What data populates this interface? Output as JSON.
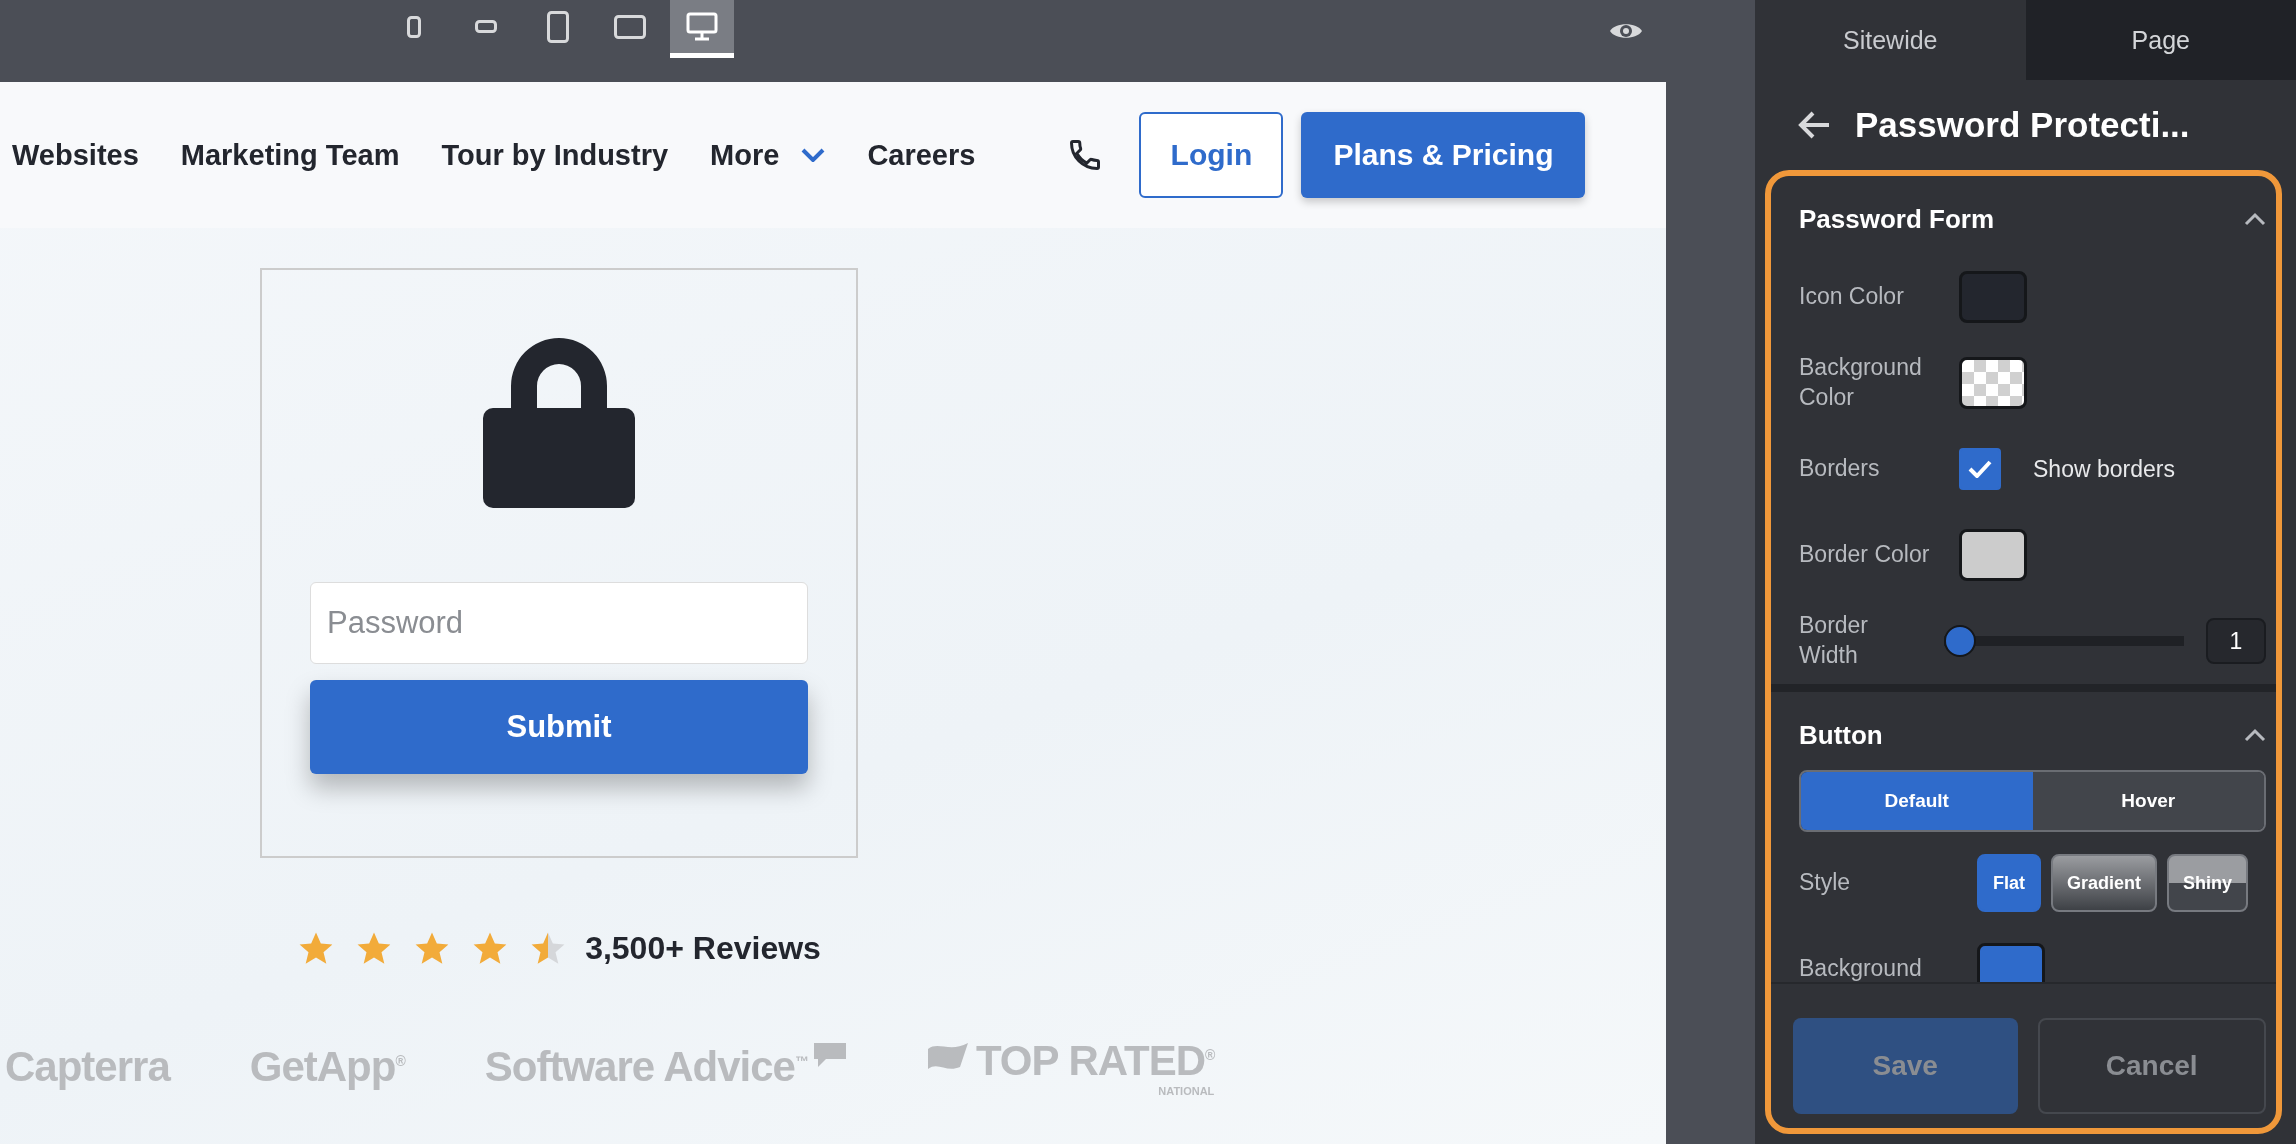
{
  "toolbar": {
    "devices": [
      {
        "kind": "phone-portrait",
        "selected": false
      },
      {
        "kind": "phone-landscape",
        "selected": false
      },
      {
        "kind": "tablet-portrait",
        "selected": false
      },
      {
        "kind": "tablet-landscape",
        "selected": false
      },
      {
        "kind": "desktop",
        "selected": true
      }
    ]
  },
  "nav": {
    "items": [
      {
        "label": "Websites",
        "dropdown": false
      },
      {
        "label": "Marketing Team",
        "dropdown": false
      },
      {
        "label": "Tour by Industry",
        "dropdown": false
      },
      {
        "label": "More",
        "dropdown": true
      },
      {
        "label": "Careers",
        "dropdown": false
      }
    ],
    "login": "Login",
    "cta": "Plans & Pricing"
  },
  "form": {
    "placeholder": "Password",
    "submit": "Submit"
  },
  "reviews": {
    "stars": 4.5,
    "text": "3,500+ Reviews"
  },
  "logos": [
    {
      "kind": "capterra",
      "text": "Capterra"
    },
    {
      "kind": "getapp",
      "text": "GetApp$^{®}$"
    },
    {
      "kind": "softwareadvice",
      "text": "Software Advice$^{™}$"
    },
    {
      "kind": "toprated",
      "text": "TOP RATED$^{®}$",
      "subtext": "NATIONAL"
    }
  ],
  "panel": {
    "tabs": [
      {
        "label": "Sitewide",
        "selected": true
      },
      {
        "label": "Page",
        "selected": false
      }
    ],
    "title": "Password Protecti...",
    "sections": [
      {
        "title": "Password Form",
        "expanded": true,
        "rows": [
          {
            "kind": "swatch",
            "label": "Icon Color",
            "color": "#23262e"
          },
          {
            "kind": "swatch",
            "label": "Background Color",
            "transparent": true
          },
          {
            "kind": "checkbox",
            "label": "Borders",
            "checked": true,
            "text": "Show borders"
          },
          {
            "kind": "swatch",
            "label": "Border Color",
            "color": "#cccccc"
          },
          {
            "kind": "slider",
            "label": "Border Width",
            "level": 0,
            "value": "1"
          }
        ]
      },
      {
        "title": "Button",
        "expanded": true,
        "states": [
          {
            "label": "Default",
            "selected": true
          },
          {
            "label": "Hover",
            "selected": false
          }
        ],
        "rows": [
          {
            "kind": "styles",
            "label": "Style",
            "options": [
              {
                "kind": "flat",
                "label": "Flat",
                "selected": true
              },
              {
                "kind": "gradient",
                "label": "Gradient",
                "selected": false
              },
              {
                "kind": "shiny",
                "label": "Shiny",
                "selected": false
              }
            ]
          },
          {
            "kind": "swatch",
            "label": "Background",
            "color": "#2f6bcb"
          }
        ]
      }
    ],
    "footer": [
      {
        "kind": "primary",
        "label": "Save",
        "disabled": true
      },
      {
        "kind": "secondary",
        "label": "Cancel",
        "disabled": true
      }
    ]
  }
}
